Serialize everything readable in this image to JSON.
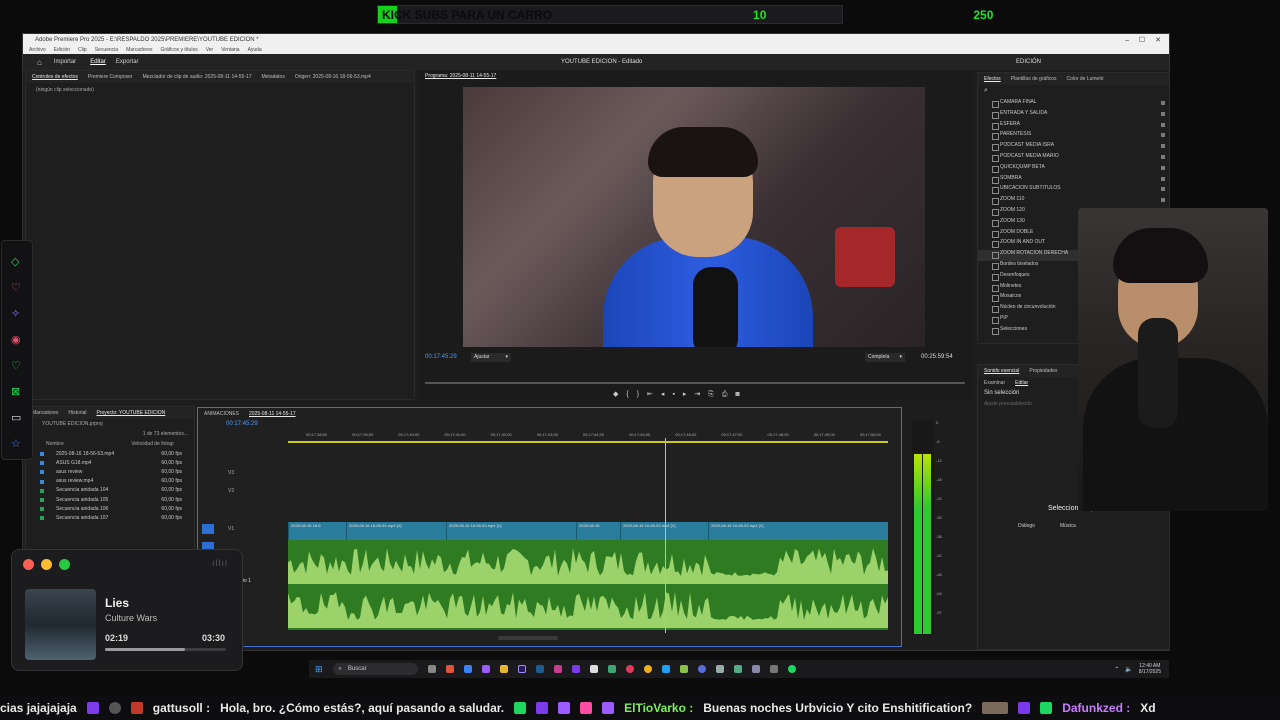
{
  "banner": {
    "title": "KICK SUBS PARA UN CARRO",
    "current": "10",
    "goal": "250",
    "progress": 0.04,
    "accent": "#16d11b"
  },
  "premiere": {
    "window_title": "Adobe Premiere Pro 2025 - E:\\RESPALDO 2025\\PREMIERE\\YOUTUBE EDICION *",
    "menus": [
      "Archivo",
      "Edición",
      "Clip",
      "Secuencia",
      "Marcadores",
      "Gráficos y títulos",
      "Ver",
      "Ventana",
      "Ayuda"
    ],
    "workspaces": [
      "Importar",
      "Editar",
      "Exportar"
    ],
    "project_title": "YOUTUBE EDICION - Editado",
    "workspace_right": "EDICIÓN",
    "source_tabs": [
      "Controles de efectos",
      "Premiere Composer",
      "Mezclador de clip de audio: 2025-08-11 14-55-17",
      "Metadatos",
      "Origen: 2025-08-16 18-56-53.mp4"
    ],
    "no_clip": "(ningún clip seleccionado)",
    "program_tab": "Programa: 2025-08-11 14-55-17",
    "program_timecode": "00:17:45:29",
    "fit": "Ajustar",
    "quality": "Completa",
    "duration": "00:25:59:54",
    "effects_tabs": [
      "Efectos",
      "Plantillas de gráficos",
      "Color de Lumetri"
    ],
    "effects_items": [
      "CAMARA FINAL",
      "ENTRADA Y SALIDA",
      "ESFERA",
      "PARENTESIS",
      "PODCAST MEDIA ISRA",
      "PODCAST MEDIA MARIO",
      "QUICKQUMP BETA",
      "SOMBRA",
      "UBICACION SUBTITULOS",
      "ZOOM 110",
      "ZOOM 120",
      "ZOOM 130",
      "ZOOM DOBLE",
      "ZOOM IN AND OUT",
      "ZOOM ROTACION DERECHA",
      "Bordes biselados",
      "Desenfoques",
      "Molinetes",
      "Mosaicos",
      "Núcleo de circunvolución",
      "PiP",
      "Selecciones"
    ],
    "essential_sound_tabs": [
      "Sonido esencial",
      "Propiedades"
    ],
    "es_subtabs": [
      "Examinar",
      "Editar"
    ],
    "no_selection": "Sin selección",
    "preset_label": "Ajuste preestablecido",
    "select_clips": "Seleccione clips",
    "dialog_label": "Diálogo",
    "music_label": "Música",
    "project_tabs": [
      "Marcadores",
      "Historial",
      "Proyecto: YOUTUBE EDICION"
    ],
    "project_file": "YOUTUBE EDICION.prproj",
    "items_count": "1 de 73 elementos...",
    "col_name": "Nombre",
    "col_fps": "Velocidad de fotogr",
    "project_items": [
      {
        "name": "2025-08-16 18-56-53.mp4",
        "fps": "60,00 fps"
      },
      {
        "name": "ASUS G18.mp4",
        "fps": "60,00 fps"
      },
      {
        "name": "asus review",
        "fps": "60,00 fps"
      },
      {
        "name": "asus review.mp4",
        "fps": "60,00 fps"
      },
      {
        "name": "Secuencia anidada 104",
        "fps": "60,00 fps"
      },
      {
        "name": "Secuencia anidada 105",
        "fps": "60,00 fps"
      },
      {
        "name": "Secuencia anidada 106",
        "fps": "60,00 fps"
      },
      {
        "name": "Secuencia anidada 107",
        "fps": "60,00 fps"
      }
    ],
    "timeline_tabs": [
      "ANIMACIONES",
      "2025-08-11 14-55-17"
    ],
    "timeline_timecode": "00:17:45:29",
    "ruler_ticks": [
      "00;17;38;00",
      "00;17;39;00",
      "00;17;40;00",
      "00;17;41;00",
      "00;17;42;00",
      "00;17;43;00",
      "00;17;44;00",
      "00;17;45;00",
      "00;17;46;00",
      "00;17;47;00",
      "00;17;48;00",
      "00;17;49;00",
      "00;17;50;00"
    ],
    "tracks": [
      "V3",
      "V2",
      "V1",
      "A1"
    ],
    "audio_track_name": "Audio 1",
    "clip_labels": [
      "2025-08-16 18-5",
      "2025-08-16 18-56-53.mp4 [V]",
      "2025-08-16 18-56-53.mp4 [V]",
      "2025-08-16",
      "2025-08-16 18-56-53.mp4 [V]",
      "2025-08-16 18-56-53.mp4 [V]"
    ],
    "meter_ticks": [
      "0",
      "-6",
      "-12",
      "-18",
      "-24",
      "-30",
      "-36",
      "-42",
      "-48",
      "-54",
      "-57"
    ]
  },
  "music": {
    "title": "Lies",
    "artist": "Culture Wars",
    "elapsed": "02:19",
    "total": "03:30",
    "progress": 0.66
  },
  "taskbar": {
    "search": "Buscar",
    "time": "12:40 AM",
    "date": "8/17/2025"
  },
  "chat": {
    "fragment": "cias jajajajaja",
    "msg1_user": "gattusoll :",
    "msg1_text": "Hola, bro. ¿Cómo estás?, aquí pasando a saludar.",
    "msg2_user": "ElTioVarko :",
    "msg2_text": "Buenas noches Urbvicio  Y cito  Enshitification?",
    "msg3_user": "Dafunkzed :",
    "msg3_text": "Xd"
  }
}
